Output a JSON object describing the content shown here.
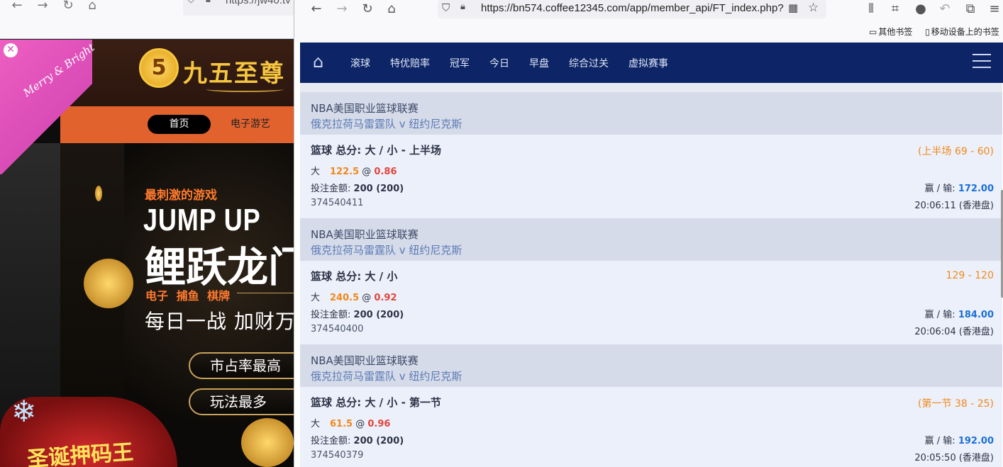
{
  "left_browser": {
    "url_visible": "https://jw40.tv"
  },
  "left_site": {
    "logo_text": "九五至尊",
    "logo_mark": "5",
    "nav": {
      "home": "首页",
      "slots": "电子游艺"
    },
    "promo": {
      "tag": "最刺激的游戏",
      "title": "JUMP UP",
      "title_cn": "鲤跃龙门",
      "categories": "电子 捕鱼 棋牌",
      "slogan": "每日一战 加财万",
      "pill_1": "市占率最高",
      "pill_2": "玩法最多"
    },
    "xmas_ad": {
      "text": "Merry & Bright",
      "badge": "圣诞押码王"
    }
  },
  "right_browser": {
    "url": "https://bn574.coffee12345.com/app/member_api/FT_index.php?",
    "bookmarks": [
      "其他书签",
      "移动设备上的书签"
    ]
  },
  "app_nav": {
    "items": [
      "滚球",
      "特优赔率",
      "冠军",
      "今日",
      "早盘",
      "综合过关",
      "虚拟赛事"
    ]
  },
  "bets": [
    {
      "league": "NBA美国职业篮球联赛",
      "teams": "俄克拉荷马雷霆队  v  纽约尼克斯",
      "market": "篮球 总分: 大 / 小 - 上半场",
      "score": "(上半场 69 - 60)",
      "pick": "大",
      "line": "122.5",
      "at": "@",
      "odds": "0.86",
      "stake_label": "投注金额:",
      "stake_value": "200 (200)",
      "winloss_label": "赢 / 输:",
      "winloss_value": "172.00",
      "ticket": "374540411",
      "time": "20:06:11 (香港盘)"
    },
    {
      "league": "NBA美国职业篮球联赛",
      "teams": "俄克拉荷马雷霆队  v  纽约尼克斯",
      "market": "篮球 总分: 大 / 小",
      "score": "129 - 120",
      "pick": "大",
      "line": "240.5",
      "at": "@",
      "odds": "0.92",
      "stake_label": "投注金额:",
      "stake_value": "200 (200)",
      "winloss_label": "赢 / 输:",
      "winloss_value": "184.00",
      "ticket": "374540400",
      "time": "20:06:04 (香港盘)"
    },
    {
      "league": "NBA美国职业篮球联赛",
      "teams": "俄克拉荷马雷霆队  v  纽约尼克斯",
      "market": "篮球 总分: 大 / 小 - 第一节",
      "score": "(第一节 38 - 25)",
      "pick": "大",
      "line": "61.5",
      "at": "@",
      "odds": "0.96",
      "stake_label": "投注金额:",
      "stake_value": "200 (200)",
      "winloss_label": "赢 / 输:",
      "winloss_value": "192.00",
      "ticket": "374540379",
      "time": "20:05:50 (香港盘)"
    }
  ],
  "colors": {
    "nav_bg": "#0d2566",
    "accent_orange": "#f0881a",
    "odds_red": "#e2453b",
    "winloss_blue": "#1a6fd8",
    "header_bg": "#d5dbe9",
    "body_bg": "#ecf0fa"
  }
}
